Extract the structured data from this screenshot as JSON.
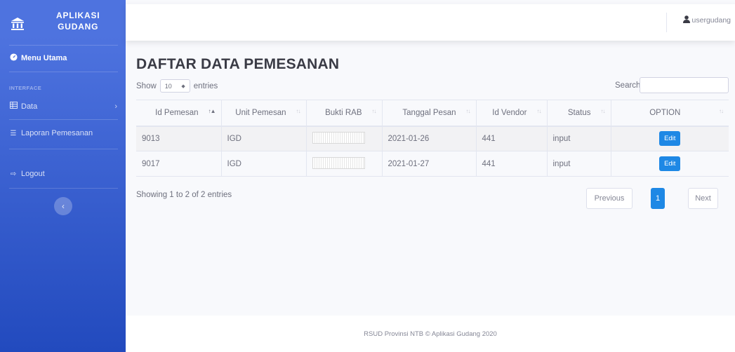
{
  "sidebar": {
    "brand_line1": "APLIKASI",
    "brand_line2": "GUDANG",
    "menu_utama": "Menu Utama",
    "heading": "INTERFACE",
    "data": "Data",
    "laporan": "Laporan Pemesanan",
    "logout": "Logout"
  },
  "topbar": {
    "username": "usergudang"
  },
  "page": {
    "title": "DAFTAR DATA PEMESANAN",
    "show_label": "Show",
    "entries_value": "10",
    "entries_label": "entries",
    "search_label": "Search:",
    "search_value": ""
  },
  "table": {
    "columns": [
      "Id Pemesan",
      "Unit Pemesan",
      "Bukti RAB",
      "Tanggal Pesan",
      "Id Vendor",
      "Status",
      "OPTION"
    ],
    "rows": [
      {
        "id": "9013",
        "unit": "IGD",
        "tanggal": "2021-01-26",
        "vendor": "441",
        "status": "input",
        "option": "Edit"
      },
      {
        "id": "9017",
        "unit": "IGD",
        "tanggal": "2021-01-27",
        "vendor": "441",
        "status": "input",
        "option": "Edit"
      }
    ]
  },
  "pagination": {
    "info": "Showing 1 to 2 of 2 entries",
    "previous": "Previous",
    "current": "1",
    "next": "Next"
  },
  "footer": {
    "text": "RSUD Provinsi NTB © Aplikasi Gudang 2020"
  },
  "colors": {
    "sidebar": "#4e73df",
    "primary_button": "#1e88e5"
  },
  "icons": {
    "brand": "bank-icon",
    "menu": "tachometer-icon",
    "data": "table-icon",
    "laporan": "list-icon",
    "logout": "sign-out-icon",
    "user": "user-icon",
    "toggle": "chevron-left-icon"
  }
}
